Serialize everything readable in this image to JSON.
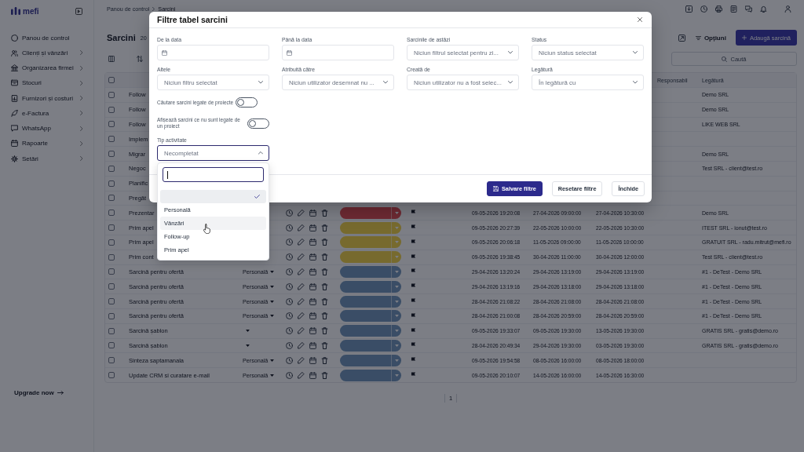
{
  "sidebar": {
    "logo": "mefi",
    "items": [
      {
        "label": "Panou de control",
        "submenu": false
      },
      {
        "label": "Clienți și vânzări",
        "submenu": true
      },
      {
        "label": "Organizarea firmei",
        "submenu": true
      },
      {
        "label": "Stocuri",
        "submenu": true
      },
      {
        "label": "Furnizori și costuri",
        "submenu": true
      },
      {
        "label": "e-Factura",
        "submenu": true
      },
      {
        "label": "WhatsApp",
        "submenu": true
      },
      {
        "label": "Rapoarte",
        "submenu": true
      },
      {
        "label": "Setări",
        "submenu": true
      }
    ],
    "upgrade_link": "Upgrade now"
  },
  "header": {
    "breadcrumb": [
      "Panou de control",
      "Sarcini"
    ]
  },
  "page": {
    "title": "Sarcini",
    "count": "20",
    "options_button": "Opțiuni",
    "add_button": "Adaugă sarcină",
    "search": {
      "placeholder": "Caută"
    }
  },
  "table": {
    "select_all": {
      "checked": false
    },
    "columns": [
      {
        "label": "Responsabil"
      },
      {
        "label": "Legătură"
      }
    ],
    "rows": [
      {
        "kind": "covered",
        "checked": false,
        "title": "Follow",
        "link": "Demo SRL"
      },
      {
        "kind": "covered",
        "checked": false,
        "title": "Follow",
        "link": "Demo SRL"
      },
      {
        "kind": "covered",
        "checked": false,
        "title": "Follow",
        "link": "LIKE WEB SRL"
      },
      {
        "kind": "covered",
        "checked": false,
        "title": "Implem"
      },
      {
        "kind": "covered",
        "checked": false,
        "title": "Migrar",
        "link": "Demo SRL"
      },
      {
        "kind": "covered",
        "checked": false,
        "title": "Negoc",
        "link": "Test SRL - client@test.ro"
      },
      {
        "kind": "covered",
        "checked": false,
        "title": "Planific"
      },
      {
        "kind": "covered",
        "checked": false,
        "title": "Pregăt"
      },
      {
        "kind": "full",
        "checked": false,
        "title": "Prezentar",
        "status": {
          "color": "#6e2a34"
        },
        "created": "09-05-2026 19:20:08",
        "start": "27-04-2026 09:00:00",
        "end": "27-04-2026 10:30:00",
        "link": "Demo SRL"
      },
      {
        "kind": "full",
        "checked": false,
        "title": "Prim apel",
        "status": {
          "color": "#766a2e"
        },
        "created": "09-05-2026 20:27:39",
        "start": "22-05-2026 10:00:00",
        "end": "22-05-2026 10:30:00",
        "link": "ITEST SRL - ionut@test.ro"
      },
      {
        "kind": "full",
        "checked": false,
        "title": "Prim apel",
        "status": {
          "color": "#766a2e"
        },
        "created": "09-05-2026 20:06:18",
        "start": "11-05-2026 09:00:00",
        "end": "11-05-2026 10:00:00",
        "link": "GRATUIT SRL - radu.mitrut@mefi.ro"
      },
      {
        "kind": "full",
        "checked": false,
        "title": "Prim cont",
        "status": {
          "color": "#766a2e"
        },
        "created": "09-05-2026 19:38:45",
        "start": "30-04-2026 11:00:00",
        "end": "30-04-2026 12:00:00",
        "link": "Test SRL - client@test.ro"
      },
      {
        "kind": "full",
        "checked": false,
        "title": "Sarcină pentru ofertă",
        "type": "Personală",
        "type_menu": true,
        "status": {
          "color": "#3a4d66"
        },
        "created": "29-04-2026 13:20:24",
        "start": "29-04-2026 13:19:00",
        "end": "29-04-2026 13:19:00",
        "link": "#1 - DeTest - Demo SRL"
      },
      {
        "kind": "full",
        "checked": false,
        "title": "Sarcină pentru ofertă",
        "type": "Personală",
        "type_menu": true,
        "status": {
          "color": "#3a4d66"
        },
        "created": "29-04-2026 13:19:16",
        "start": "29-04-2026 13:18:00",
        "end": "29-04-2026 13:18:00",
        "link": "#1 - DeTest - Demo SRL"
      },
      {
        "kind": "full",
        "checked": false,
        "title": "Sarcină pentru ofertă",
        "type": "Personală",
        "type_menu": true,
        "status": {
          "color": "#3a4d66"
        },
        "created": "28-04-2026 21:08:22",
        "start": "28-04-2026 21:08:00",
        "end": "28-04-2026 21:08:00",
        "link": "#1 - DeTest - Demo SRL"
      },
      {
        "kind": "full",
        "checked": false,
        "title": "Sarcină pentru ofertă",
        "type": "Personală",
        "type_menu": true,
        "status": {
          "color": "#3a4d66"
        },
        "created": "28-04-2026 21:00:08",
        "start": "28-04-2026 20:59:00",
        "end": "28-04-2026 20:59:00",
        "link": "#1 - DeTest - Demo SRL"
      },
      {
        "kind": "full",
        "checked": false,
        "title": "Sarcină șablon",
        "type_menu": true,
        "status": {
          "color": "#3a4d66"
        },
        "created": "09-05-2026 19:33:07",
        "start": "09-05-2026 19:30:00",
        "end": "13-05-2026 19:30:00",
        "link": "GRATIS SRL - gratis@demo.ro"
      },
      {
        "kind": "full",
        "checked": false,
        "title": "Sarcină șablon",
        "type_menu": true,
        "status": {
          "color": "#3a4d66"
        },
        "created": "28-04-2026 20:49:34",
        "start": "29-04-2026 19:30:00",
        "end": "03-05-2026 19:30:00",
        "link": "GRATIS SRL - gratis@demo.ro"
      },
      {
        "kind": "full",
        "checked": false,
        "title": "Sinteza saptamanala",
        "type": "Personală",
        "type_menu": true,
        "status": {
          "color": "#3a4d66"
        },
        "created": "09-05-2026 19:54:58",
        "start": "08-05-2026 16:00:00",
        "end": "08-05-2026 18:00:00"
      },
      {
        "kind": "full",
        "checked": false,
        "title": "Update CRM si curatare e-mail",
        "type": "Personală",
        "type_menu": true,
        "status": {
          "color": "#3a4d66"
        },
        "created": "09-05-2026 20:10:07",
        "start": "14-05-2026 16:00:00",
        "end": "14-05-2026 16:30:00"
      }
    ]
  },
  "pagination": {
    "current_page": "1"
  },
  "filter_dialog": {
    "title": "Filtre tabel sarcini",
    "fields": [
      {
        "label": "De la data",
        "kind": "date"
      },
      {
        "label": "Până la data",
        "kind": "date"
      },
      {
        "label": "Sarcinile de astăzi",
        "kind": "select",
        "placeholder": "Niciun filtrul selectat pentru zi..."
      },
      {
        "label": "Status",
        "kind": "select",
        "placeholder": "Niciun status selectat"
      },
      {
        "label": "Altele",
        "kind": "select",
        "placeholder": "Niciun filtru selectat"
      },
      {
        "label": "Atribuită către",
        "kind": "select",
        "placeholder": "Niciun utilizator desemnat nu ..."
      },
      {
        "label": "Creată de",
        "kind": "select",
        "placeholder": "Niciun utilizator nu a fost selec..."
      },
      {
        "label": "Legătură",
        "kind": "select",
        "placeholder": "În legătură cu"
      }
    ],
    "toggles": [
      {
        "label": "Căutare sarcini legate de proiecte",
        "on": false
      },
      {
        "label": "Afișează sarcini ce nu sunt legate de un proiect",
        "on": false
      }
    ],
    "activity_type": {
      "label": "Tip activitate",
      "placeholder": "Necompletat",
      "expanded": true,
      "search_focused": true,
      "options": [
        {
          "selected": true,
          "hovered": false
        },
        {
          "label": "Personală",
          "selected": false,
          "hovered": false
        },
        {
          "label": "Vânzări",
          "selected": false,
          "hovered": true
        },
        {
          "label": "Follow-up",
          "selected": false,
          "hovered": false
        },
        {
          "label": "Prim apel",
          "selected": false,
          "hovered": false
        }
      ]
    },
    "buttons": [
      {
        "label": "Salvare filtre",
        "kind": "save"
      },
      {
        "label": "Resetare filtre",
        "kind": "reset"
      },
      {
        "label": "Închide",
        "kind": "close"
      }
    ]
  }
}
